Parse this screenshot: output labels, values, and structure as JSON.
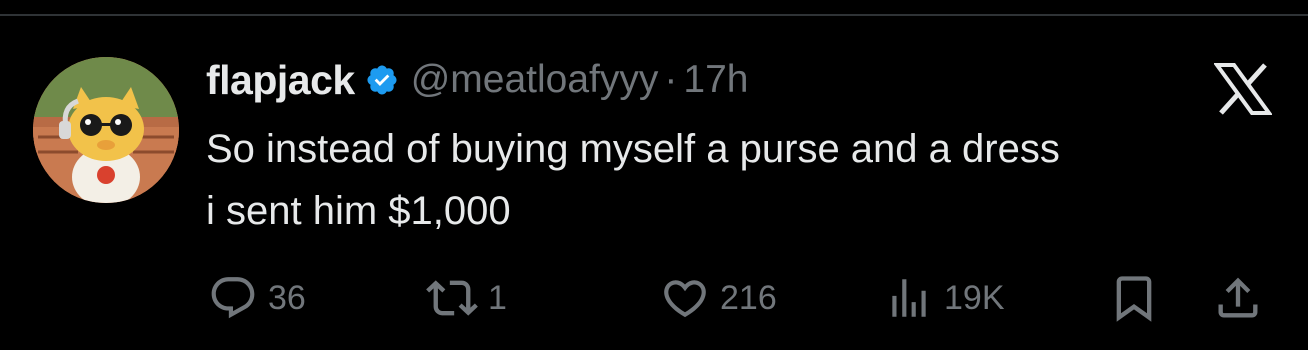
{
  "tweet": {
    "author": {
      "display_name": "flapjack",
      "handle": "@meatloafyyy",
      "verified": true
    },
    "separator": "·",
    "time": "17h",
    "text_lines": [
      "So instead of buying myself a purse and a dress",
      "i sent him $1,000"
    ],
    "stats": {
      "replies": "36",
      "reposts": "1",
      "likes": "216",
      "views": "19K"
    }
  },
  "icons": {
    "verified": "verified-badge-icon",
    "brand": "x-logo-icon",
    "reply": "reply-icon",
    "repost": "repost-icon",
    "like": "heart-icon",
    "views": "views-icon",
    "bookmark": "bookmark-icon",
    "share": "share-icon"
  },
  "colors": {
    "background": "#000000",
    "text_primary": "#e7e9ea",
    "text_secondary": "#71767b",
    "verified_blue": "#1d9bf0",
    "divider": "#2f3336"
  }
}
